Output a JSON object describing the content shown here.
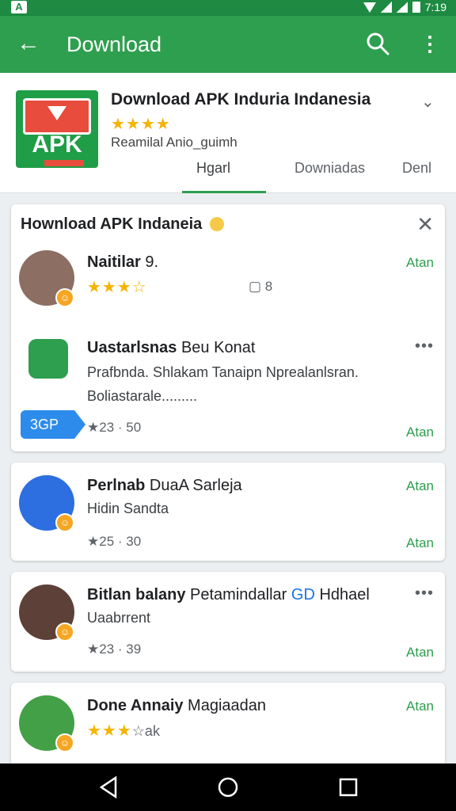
{
  "status": {
    "time": "7:19"
  },
  "appbar": {
    "title": "Download"
  },
  "header": {
    "app_title": "Download APK Induria Indanesia",
    "stars": "★★★★",
    "subtitle": "Reamilal Anio_guimh",
    "logo_text": "APK",
    "tabs": [
      "Hgarl",
      "Downiadas",
      "Denl"
    ]
  },
  "card1": {
    "title": "Hownload APK Indaneia",
    "item1": {
      "name": "Naitilar",
      "name_rest": " 9.",
      "stars": "★★★☆",
      "action": "Atan",
      "count": "8"
    },
    "item2": {
      "name": "Uastarlsnas",
      "name_rest": " Beu Konat",
      "desc1": "Prafbnda. Shlakam Tanaipn Nprealanlsran.",
      "desc2": "Boliastarale.........",
      "pill": "3GP",
      "rating": "★23 · 50",
      "action": "Atan"
    }
  },
  "card2": {
    "name": "Perlnab",
    "name_rest": " DuaA Sarleja",
    "line": "Hidin Sandta",
    "rating": "★25 · 30",
    "action_top": "Atan",
    "action_bottom": "Atan"
  },
  "card3": {
    "name": "Bitlan balany",
    "name_rest": " Petamindallar",
    "name_blue": "GD",
    "name_end": " Hdhael",
    "line": "Uaabrrent",
    "rating": "★23 · 39",
    "action": "Atan"
  },
  "card4": {
    "name": "Done Annaiy",
    "name_rest": " Magiaadan",
    "stars": "★★★",
    "stars_rest": "☆ak",
    "action": "Atan"
  },
  "colors": {
    "appbar": "#2e9e4f",
    "statusbar": "#1e8a42",
    "accent": "#2e9e4f",
    "star": "#f4b400",
    "pill": "#2d8ceb"
  }
}
